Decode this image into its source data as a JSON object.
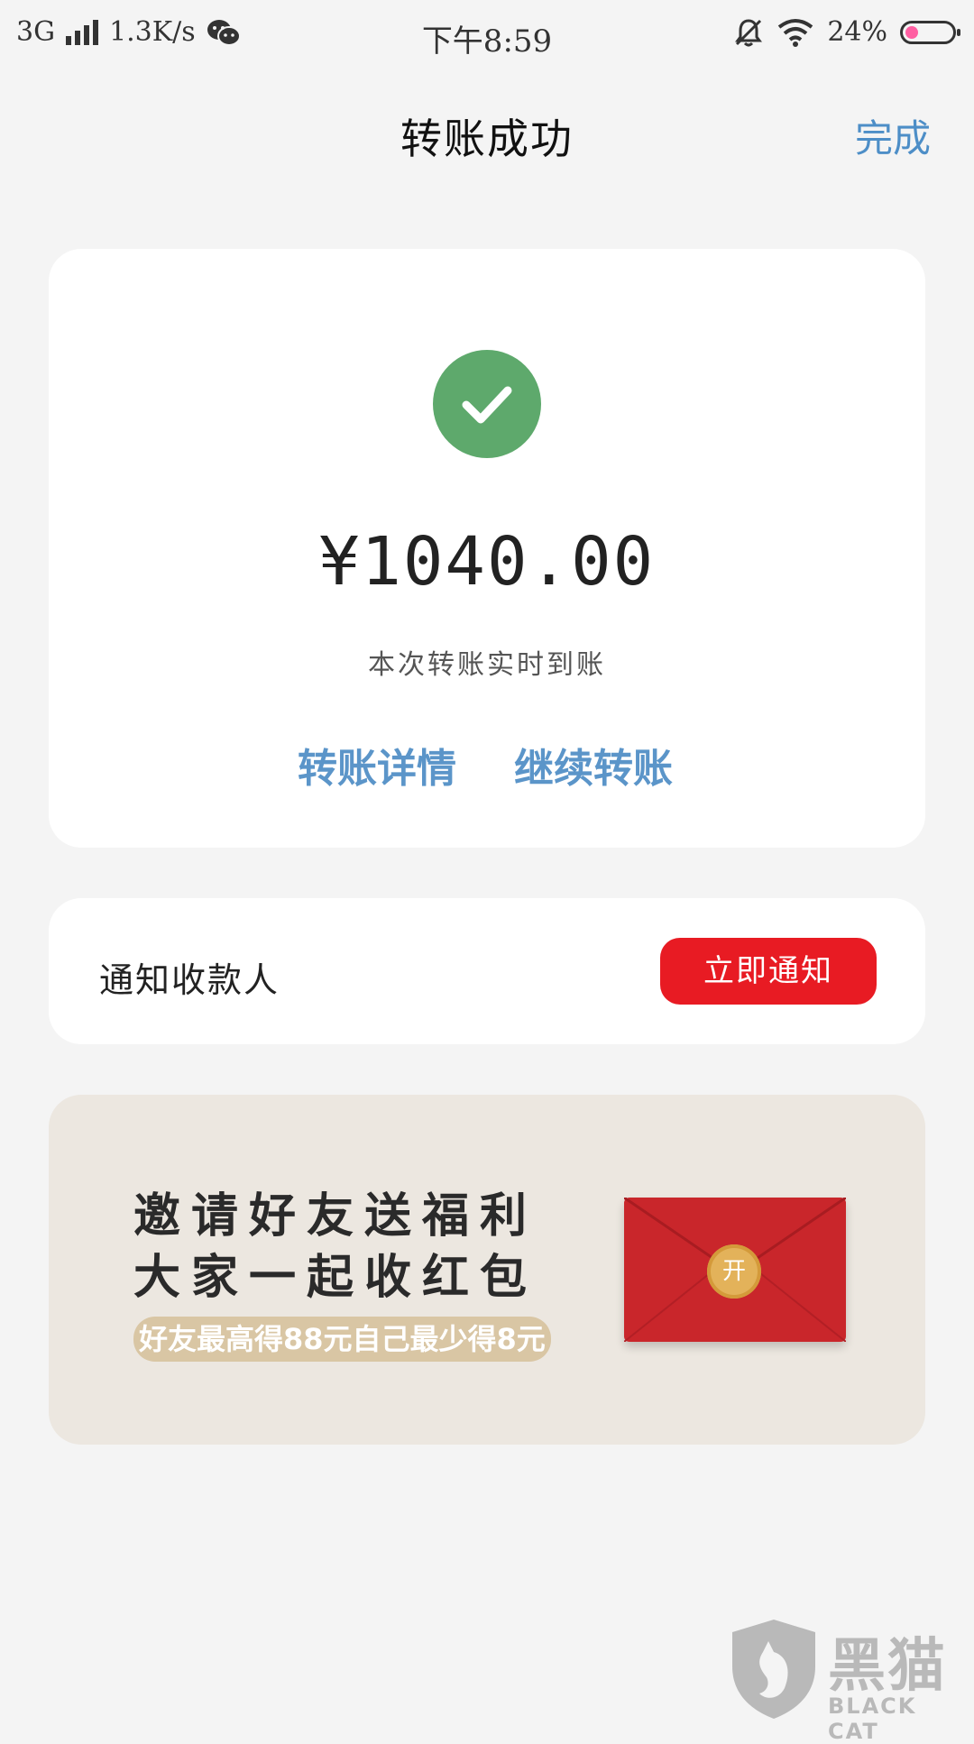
{
  "status_bar": {
    "network": "3G",
    "speed": "1.3K/s",
    "time": "下午8:59",
    "battery": "24%",
    "battery_level": 0.24
  },
  "nav": {
    "title": "转账成功",
    "done_label": "完成",
    "accent_color": "#4d8ec7"
  },
  "result": {
    "amount": "¥1040.00",
    "note": "本次转账实时到账",
    "detail_link": "转账详情",
    "continue_link": "继续转账",
    "success_color": "#5ea96c"
  },
  "notify": {
    "label": "通知收款人",
    "button_label": "立即通知",
    "button_color": "#e81b23"
  },
  "banner": {
    "line1": "邀请好友送福利",
    "line2": "大家一起收红包",
    "pill_text": "好友最高得88元自己最少得8元",
    "seal_text": "开"
  },
  "watermark": {
    "title": "黑猫",
    "subtitle": "BLACK CAT"
  }
}
